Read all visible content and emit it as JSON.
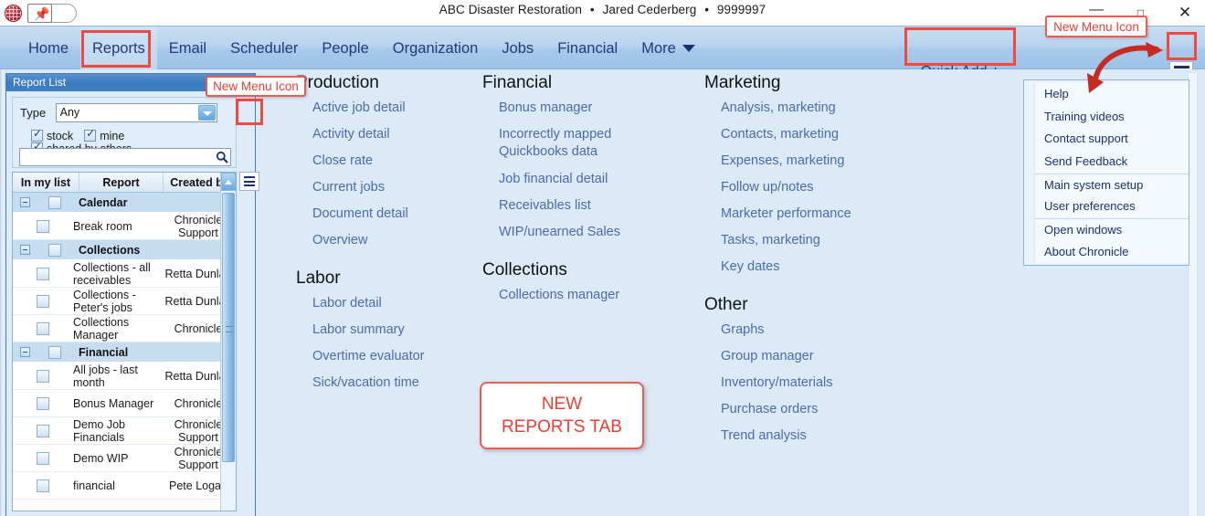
{
  "titlebar": {
    "company": "ABC Disaster Restoration",
    "user": "Jared Cederberg",
    "account": "9999997",
    "separator": "•",
    "minimize": "—",
    "maximize": "❐",
    "close": "✕",
    "pin_glyph": "📌"
  },
  "nav": {
    "items": [
      {
        "label": "Home",
        "active": false
      },
      {
        "label": "Reports",
        "active": true
      },
      {
        "label": "Email",
        "active": false
      },
      {
        "label": "Scheduler",
        "active": false
      },
      {
        "label": "People",
        "active": false
      },
      {
        "label": "Organization",
        "active": false
      },
      {
        "label": "Jobs",
        "active": false
      },
      {
        "label": "Financial",
        "active": false
      },
      {
        "label": "More",
        "active": false
      }
    ],
    "quick_add": "Quick Add +"
  },
  "panel": {
    "title": "Report List",
    "type_label": "Type",
    "type_value": "Any",
    "checkboxes": [
      {
        "label": "stock",
        "checked": true
      },
      {
        "label": "mine",
        "checked": true
      },
      {
        "label": "shared by others",
        "checked": true
      }
    ],
    "search_value": "",
    "search_placeholder": "",
    "columns": [
      "In my list",
      "Report",
      "Created by"
    ],
    "rows": [
      {
        "kind": "group",
        "name": "Calendar"
      },
      {
        "kind": "item",
        "name": "Break room",
        "by": "Chronicle Support"
      },
      {
        "kind": "group",
        "name": "Collections"
      },
      {
        "kind": "item",
        "name": "Collections - all receivables",
        "by": "Retta Dunlap"
      },
      {
        "kind": "item",
        "name": "Collections - Peter's jobs",
        "by": "Retta Dunlap"
      },
      {
        "kind": "item",
        "name": "Collections Manager",
        "by": "Chronicle"
      },
      {
        "kind": "group",
        "name": "Financial"
      },
      {
        "kind": "item",
        "name": "All jobs - last month",
        "by": "Retta Dunlap"
      },
      {
        "kind": "item",
        "name": "Bonus Manager",
        "by": "Chronicle"
      },
      {
        "kind": "item",
        "name": "Demo Job Financials",
        "by": "Chronicle Support"
      },
      {
        "kind": "item",
        "name": "Demo WIP",
        "by": "Chronicle Support"
      },
      {
        "kind": "item",
        "name": "financial",
        "by": "Pete Logan"
      }
    ]
  },
  "content": {
    "columns": [
      {
        "sections": [
          {
            "title": "Production",
            "links": [
              "Active job detail",
              "Activity detail",
              "Close rate",
              "Current jobs",
              "Document detail",
              "Overview"
            ]
          },
          {
            "title": "Labor",
            "links": [
              "Labor detail",
              "Labor summary",
              "Overtime evaluator",
              "Sick/vacation time"
            ]
          }
        ]
      },
      {
        "sections": [
          {
            "title": "Financial",
            "links": [
              "Bonus manager",
              "Incorrectly mapped Quickbooks data",
              "Job financial detail",
              "Receivables list",
              "WIP/unearned Sales"
            ]
          },
          {
            "title": "Collections",
            "links": [
              "Collections manager"
            ]
          }
        ]
      },
      {
        "sections": [
          {
            "title": "Marketing",
            "links": [
              "Analysis, marketing",
              "Contacts, marketing",
              "Expenses, marketing",
              "Follow up/notes",
              "Marketer performance",
              "Tasks, marketing",
              "Key dates"
            ]
          },
          {
            "title": "Other",
            "links": [
              "Graphs",
              "Group manager",
              "Inventory/materials",
              "Purchase orders",
              "Trend analysis"
            ]
          }
        ]
      }
    ]
  },
  "dropdown": {
    "groups": [
      [
        "Help",
        "Training videos",
        "Contact support",
        "Send Feedback"
      ],
      [
        "Main system setup",
        "User preferences"
      ],
      [
        "Open windows",
        "About Chronicle"
      ]
    ]
  },
  "annotations": {
    "callout_menu_icon_left": "New Menu Icon",
    "callout_menu_icon_right": "New Menu Icon",
    "new_reports_tab_line1": "NEW",
    "new_reports_tab_line2": "REPORTS TAB"
  },
  "colors": {
    "annotation_red": "#ee3c33",
    "nav_text": "#23387a",
    "link_blue": "#4b6ba8",
    "panel_header_blue": "#3d7bc0",
    "workspace_bg": "#dceaf8"
  }
}
